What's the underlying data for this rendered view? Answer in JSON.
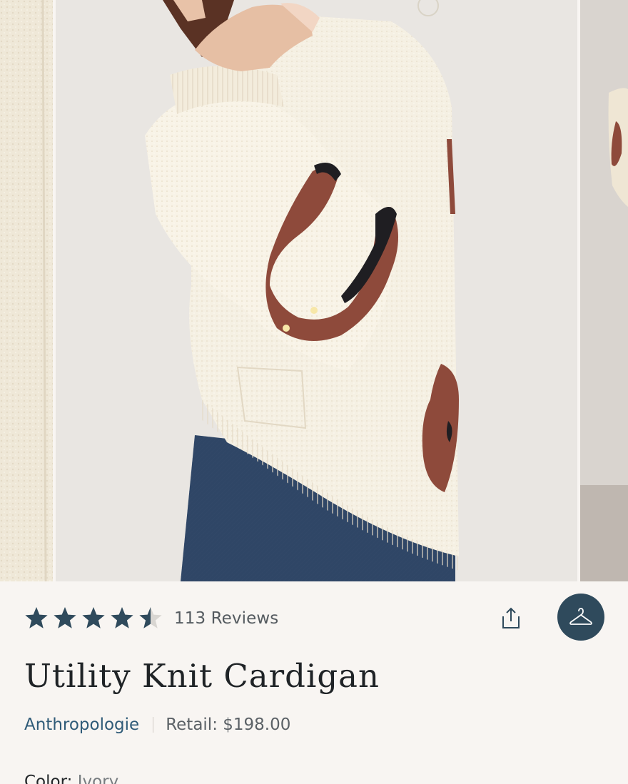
{
  "product": {
    "rating": 4.5,
    "rating_max": 5,
    "reviews_label": "113 Reviews",
    "title": "Utility Knit Cardigan",
    "brand": "Anthropologie",
    "retail_label": "Retail: $198.00",
    "color_label": "Color:",
    "color_value": "Ivory"
  },
  "colors": {
    "star_fill": "#2f4a5c",
    "star_empty": "#d9d6d2",
    "brand_link": "#2f5b78",
    "hanger_button_bg": "#2f4a5c"
  },
  "icons": {
    "share": "share-icon",
    "hanger": "hanger-icon"
  }
}
